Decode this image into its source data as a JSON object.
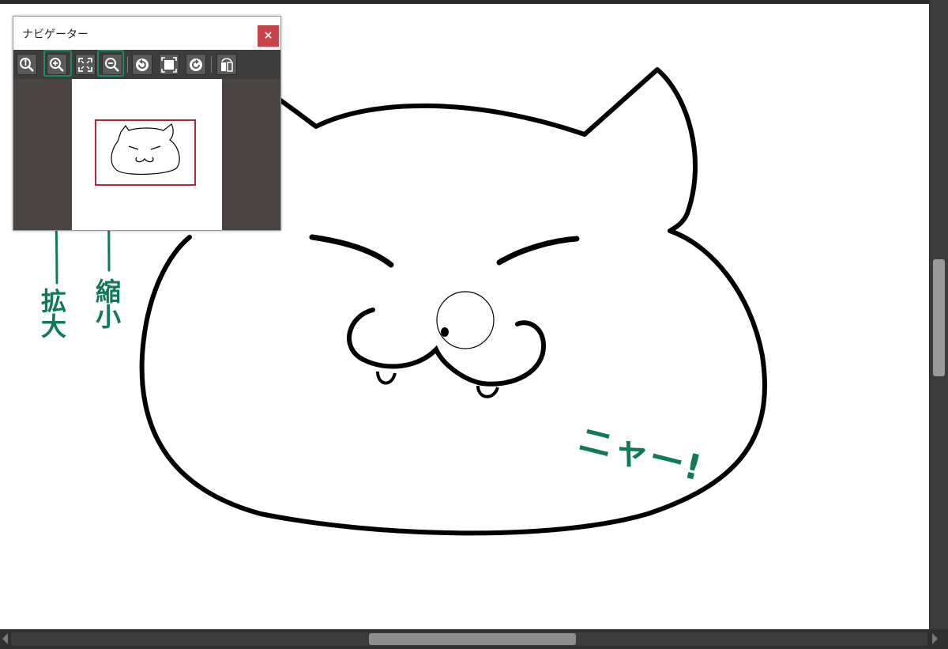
{
  "navigator": {
    "title": "ナビゲーター",
    "close_label": "×",
    "toolbar": [
      {
        "name": "actual-size-button",
        "icon": "magnifier-one-icon"
      },
      {
        "name": "zoom-in-button",
        "icon": "magnifier-plus-icon"
      },
      {
        "name": "fit-to-window-button",
        "icon": "fit-screen-icon"
      },
      {
        "name": "zoom-out-button",
        "icon": "magnifier-minus-icon"
      },
      {
        "name": "rotate-left-button",
        "icon": "rotate-ccw-icon"
      },
      {
        "name": "fit-canvas-button",
        "icon": "frame-icon"
      },
      {
        "name": "rotate-right-button",
        "icon": "rotate-cw-icon"
      },
      {
        "name": "flip-horizontal-button",
        "icon": "flip-icon"
      }
    ]
  },
  "annotations": {
    "zoom_in": "拡大",
    "zoom_out": "縮小",
    "meow": "ニャー!"
  },
  "colors": {
    "annotation": "#0f7a55",
    "close_button": "#c7454a",
    "view_rect": "#b5272d"
  }
}
